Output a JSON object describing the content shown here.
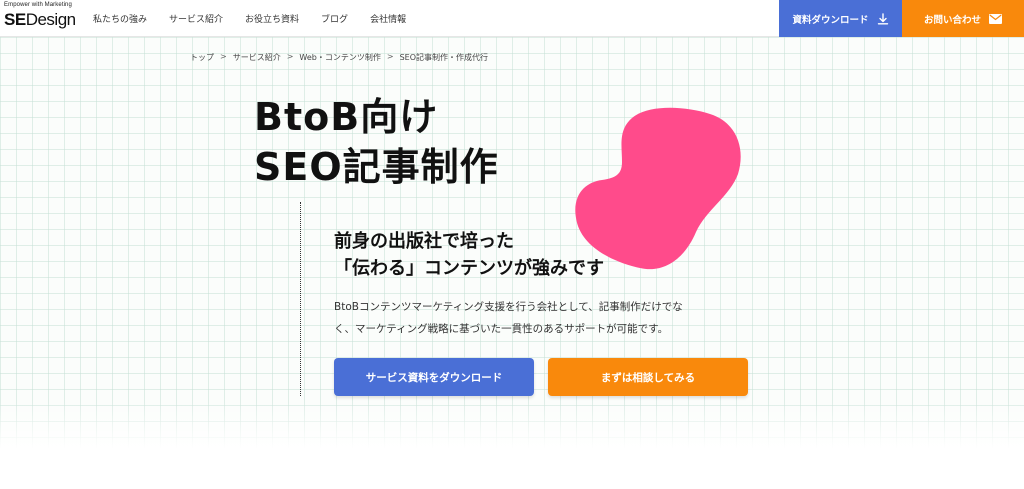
{
  "header": {
    "logo_tagline": "Empower with Marketing",
    "logo_se": "SE",
    "logo_design": "Design",
    "nav": [
      {
        "label": "私たちの強み"
      },
      {
        "label": "サービス紹介"
      },
      {
        "label": "お役立ち資料"
      },
      {
        "label": "ブログ"
      },
      {
        "label": "会社情報"
      }
    ],
    "download_label": "資料ダウンロード",
    "download_icon": "download-icon",
    "contact_label": "お問い合わせ",
    "contact_icon": "mail-icon"
  },
  "breadcrumb": [
    {
      "label": "トップ"
    },
    {
      "label": "サービス紹介"
    },
    {
      "label": "Web・コンテンツ制作"
    },
    {
      "label": "SEO記事制作・作成代行"
    }
  ],
  "breadcrumb_separator": ">",
  "hero": {
    "title_line1": "BtoB向け",
    "title_line2": "SEO記事制作",
    "subtitle_line1": "前身の出版社で培った",
    "subtitle_line2": "「伝わる」コンテンツが強みです",
    "desc_line1": "BtoBコンテンツマーケティング支援を行う会社として、記事制作だけでな",
    "desc_line2": "く、マーケティング戦略に基づいた一貫性のあるサポートが可能です。",
    "cta_download": "サービス資料をダウンロード",
    "cta_consult": "まずは相談してみる"
  },
  "colors": {
    "blue": "#4a6fd6",
    "orange": "#f9890c",
    "pink": "#ff4b8b"
  }
}
